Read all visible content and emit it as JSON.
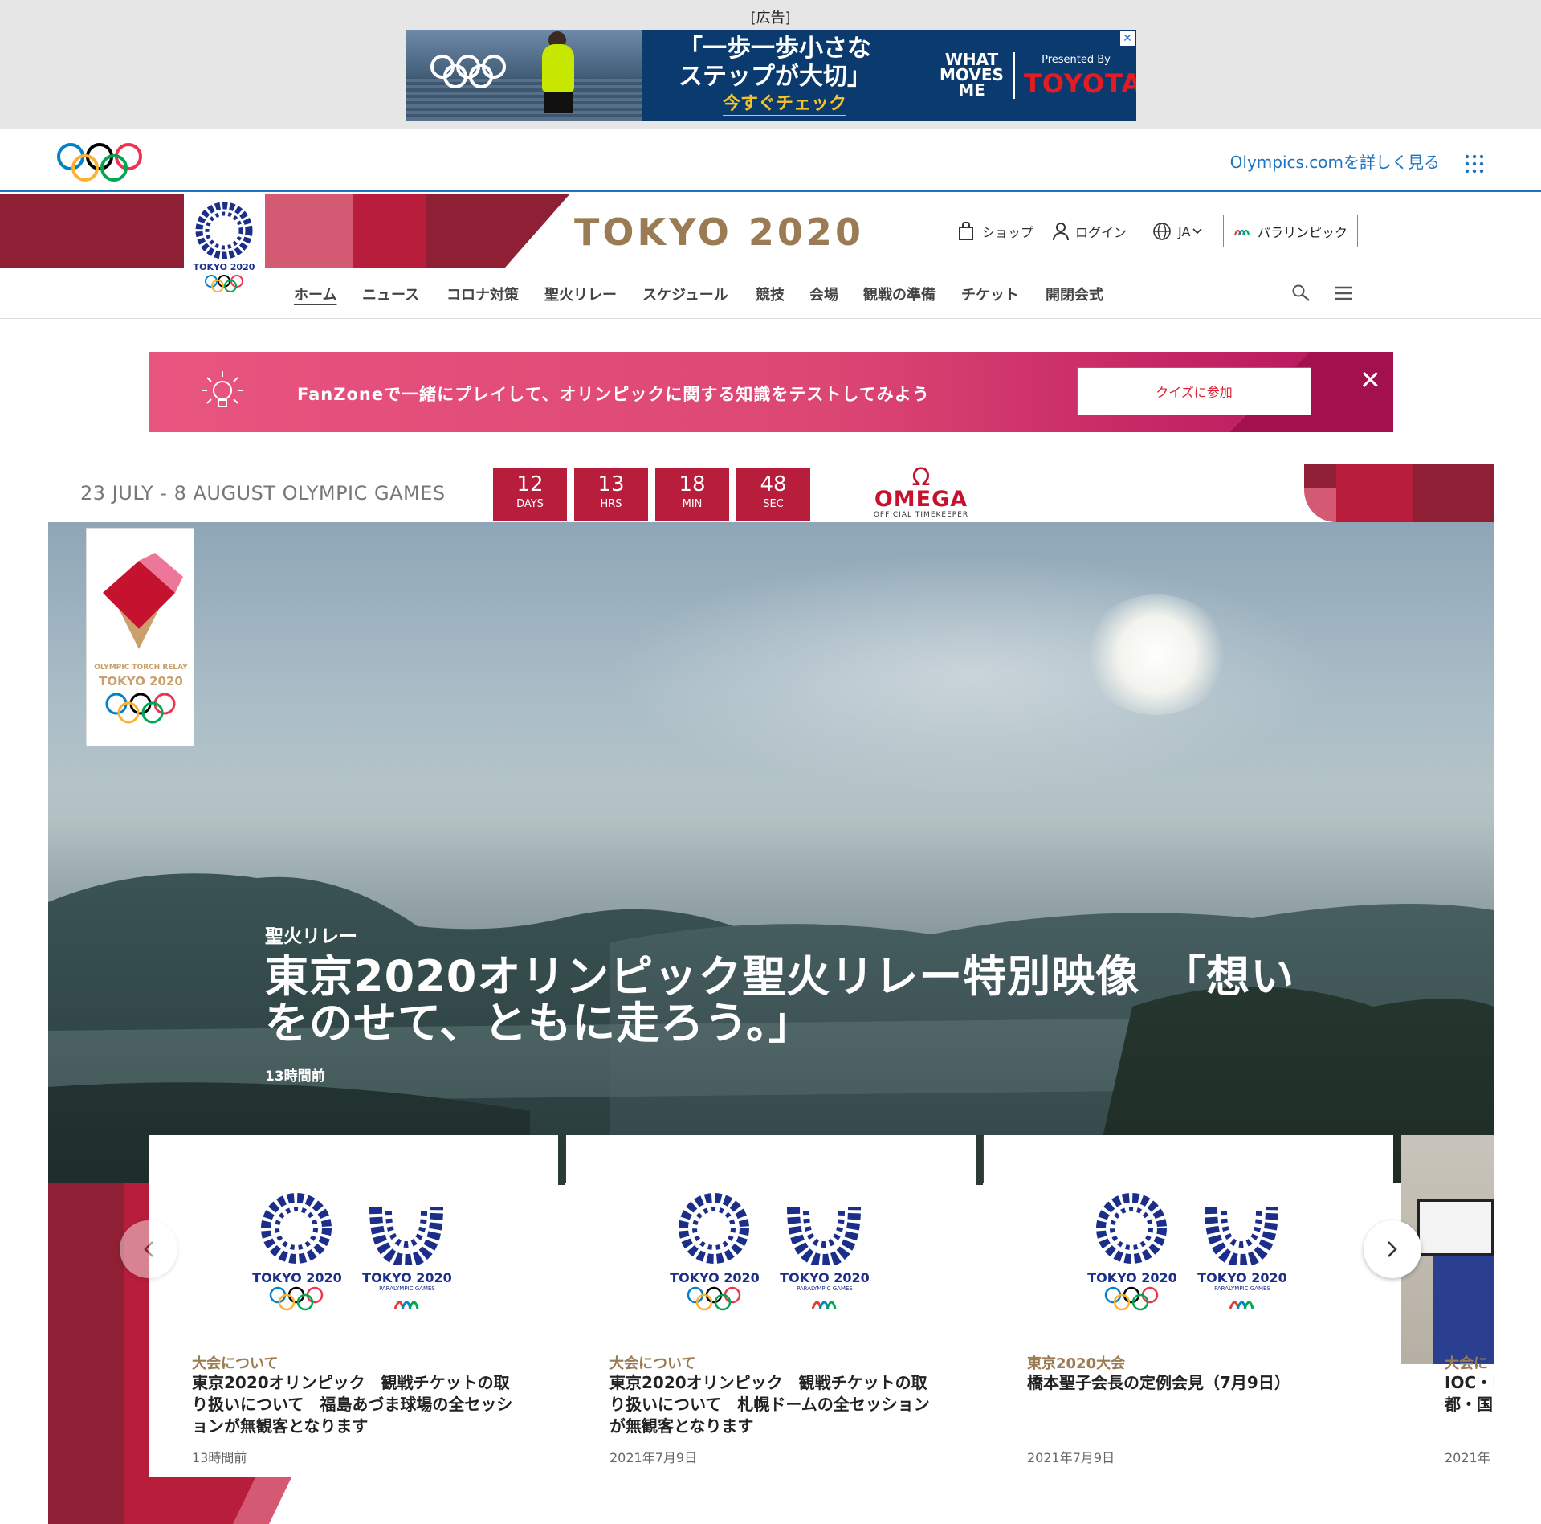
{
  "ad": {
    "label": "[広告]",
    "copy_line1": "「一歩一歩小さな",
    "copy_line2": "ステップが大切」",
    "cta": "今すぐチェック",
    "slogan_line1": "WHAT",
    "slogan_line2": "MOVES",
    "slogan_line3": "ME",
    "presented_by": "Presented By",
    "sponsor": "TOYOTA",
    "close": "✕"
  },
  "olympics_bar": {
    "link": "Olympics.comを詳しく見る"
  },
  "header": {
    "title": "TOKYO 2020",
    "emblem_text": "TOKYO 2020",
    "shop": "ショップ",
    "login": "ログイン",
    "language": "JA",
    "paralympic": "パラリンピック"
  },
  "nav": {
    "items": [
      "ホーム",
      "ニュース",
      "コロナ対策",
      "聖火リレー",
      "スケジュール",
      "競技",
      "会場",
      "観戦の準備",
      "チケット",
      "開閉会式"
    ]
  },
  "fanzone": {
    "text": "FanZoneで一緒にプレイして、オリンピックに関する知識をテストしてみよう",
    "button": "クイズに参加",
    "close": "✕"
  },
  "countdown": {
    "dates": "23 JULY - 8 AUGUST OLYMPIC GAMES",
    "days": "12",
    "days_label": "DAYS",
    "hrs": "13",
    "hrs_label": "HRS",
    "min": "18",
    "min_label": "MIN",
    "sec": "48",
    "sec_label": "SEC",
    "sponsor_name": "OMEGA",
    "sponsor_sub": "OFFICIAL TIMEKEEPER"
  },
  "torch": {
    "line1": "OLYMPIC TORCH RELAY",
    "line2": "TOKYO 2020"
  },
  "hero": {
    "category": "聖火リレー",
    "title_line1": "東京2020オリンピック聖火リレー特別映像　「想い",
    "title_line2": "をのせて、ともに走ろう。」",
    "time": "13時間前"
  },
  "cards": [
    {
      "category": "大会について",
      "title": "東京2020オリンピック　観戦チケットの取り扱いについて　福島あづま球場の全セッションが無観客となります",
      "date": "13時間前"
    },
    {
      "category": "大会について",
      "title": "東京2020オリンピック　観戦チケットの取り扱いについて　札幌ドームの全セッションが無観客となります",
      "date": "2021年7月9日"
    },
    {
      "category": "東京2020大会",
      "title": "橋本聖子会長の定例会見（7月9日）",
      "date": "2021年7月9日"
    }
  ],
  "peek_card": {
    "category": "大会に",
    "title_line1": "IOC・I",
    "title_line2": "都・国",
    "date": "2021年"
  },
  "logos": {
    "olympic_text": "TOKYO 2020",
    "paralympic_text": "TOKYO 2020",
    "paralympic_sub": "PARALYMPIC GAMES"
  },
  "colors": {
    "brand_red": "#b81d3b",
    "brand_dark": "#8f1f35",
    "brand_gold": "#9a7b53",
    "indigo": "#1b2f8a",
    "link_blue": "#1e73be"
  }
}
